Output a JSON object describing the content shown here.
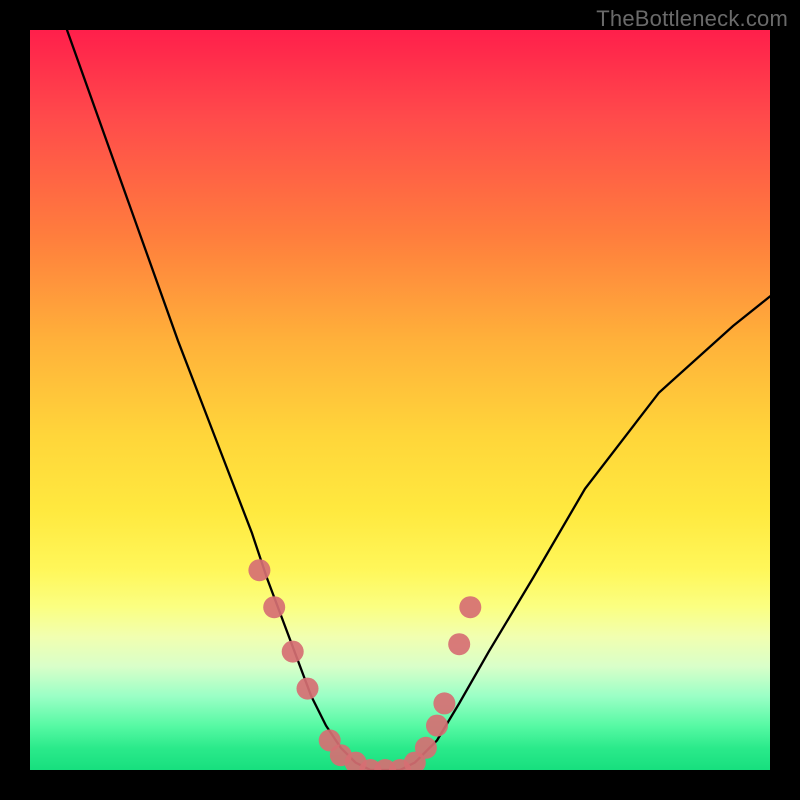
{
  "watermark": "TheBottleneck.com",
  "chart_data": {
    "type": "line",
    "title": "",
    "xlabel": "",
    "ylabel": "",
    "xlim": [
      0,
      100
    ],
    "ylim": [
      0,
      100
    ],
    "grid": false,
    "legend": false,
    "series": [
      {
        "name": "bottleneck-curve",
        "x": [
          5,
          10,
          15,
          20,
          25,
          30,
          32,
          35,
          38,
          40,
          42,
          44,
          46,
          48,
          50,
          52,
          55,
          58,
          62,
          68,
          75,
          85,
          95,
          100
        ],
        "values": [
          100,
          86,
          72,
          58,
          45,
          32,
          26,
          18,
          10,
          6,
          3,
          1,
          0,
          0,
          0,
          1,
          4,
          9,
          16,
          26,
          38,
          51,
          60,
          64
        ]
      }
    ],
    "markers": {
      "name": "highlight-points",
      "color": "#d66f73",
      "x": [
        31,
        33,
        35.5,
        37.5,
        40.5,
        42,
        44,
        46,
        48,
        50,
        52,
        53.5,
        55,
        56,
        58,
        59.5
      ],
      "values": [
        27,
        22,
        16,
        11,
        4,
        2,
        1,
        0,
        0,
        0,
        1,
        3,
        6,
        9,
        17,
        22
      ]
    },
    "green_band": {
      "y0": 0,
      "y1": 4
    }
  }
}
